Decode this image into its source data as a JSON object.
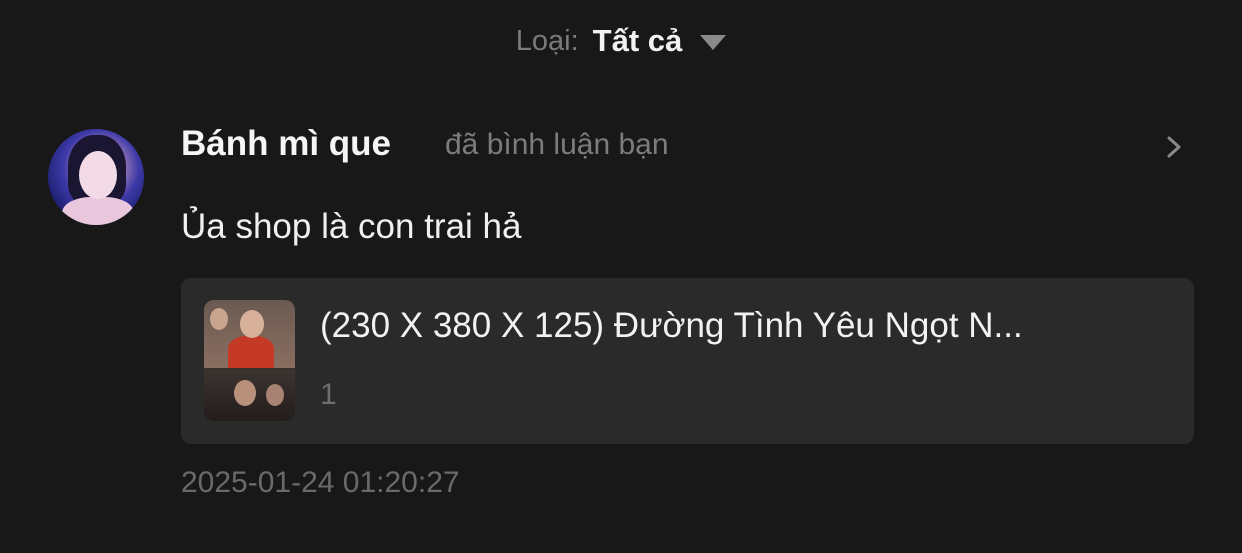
{
  "filter": {
    "label": "Loại:",
    "value": "Tất cả"
  },
  "notification": {
    "username": "Bánh mì que",
    "action": "đã bình luận bạn",
    "comment": "Ủa shop là con trai hả",
    "product": {
      "title": "(230 X 380 X 125) Đường Tình Yêu Ngọt N...",
      "quantity": "1"
    },
    "timestamp": "2025-01-24 01:20:27"
  },
  "colors": {
    "background": "#181818",
    "card": "#2a2a2a",
    "primary_text": "#f2f2f2",
    "secondary_text": "#7a7a7a"
  },
  "icons": {
    "filter_caret": "caret-down-icon",
    "chevron": "chevron-right-icon"
  }
}
